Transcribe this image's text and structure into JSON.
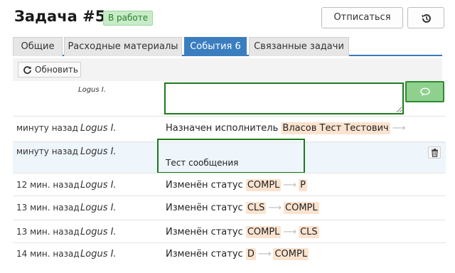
{
  "header": {
    "title": "Задача #5",
    "status_badge": "В работе",
    "unsubscribe_label": "Отписаться",
    "history_icon": "history-icon"
  },
  "tabs": [
    {
      "label": "Общие",
      "active": false
    },
    {
      "label": "Расходные материалы",
      "active": false
    },
    {
      "label": "События 6",
      "active": true
    },
    {
      "label": "Связанные задачи",
      "active": false
    }
  ],
  "toolbar": {
    "refresh_label": "Обновить",
    "refresh_icon": "refresh-icon"
  },
  "compose": {
    "author": "Logus I.",
    "value": "",
    "send_icon": "comment-icon"
  },
  "events": [
    {
      "time": "минуту назад",
      "author": "Logus I.",
      "prefix": "Назначен исполнитель",
      "from": "Власов Тест Тестович",
      "to": ""
    },
    {
      "time": "минуту назад",
      "author": "Logus I.",
      "message": "Тест сообщения",
      "delete_icon": "trash-icon"
    },
    {
      "time": "12 мин. назад",
      "author": "Logus I.",
      "prefix": "Изменён статус",
      "from": "COMPL",
      "to": "P"
    },
    {
      "time": "13 мин. назад",
      "author": "Logus I.",
      "prefix": "Изменён статус",
      "from": "CLS",
      "to": "COMPL"
    },
    {
      "time": "13 мин. назад",
      "author": "Logus I.",
      "prefix": "Изменён статус",
      "from": "COMPL",
      "to": "CLS"
    },
    {
      "time": "14 мин. назад",
      "author": "Logus I.",
      "prefix": "Изменён статус",
      "from": "D",
      "to": "COMPL"
    }
  ],
  "colors": {
    "accent": "#3a7ec0",
    "badge_bg": "#c7ecc7",
    "highlight_border": "#1d7a1d",
    "tag_bg": "#fbe3cf"
  }
}
